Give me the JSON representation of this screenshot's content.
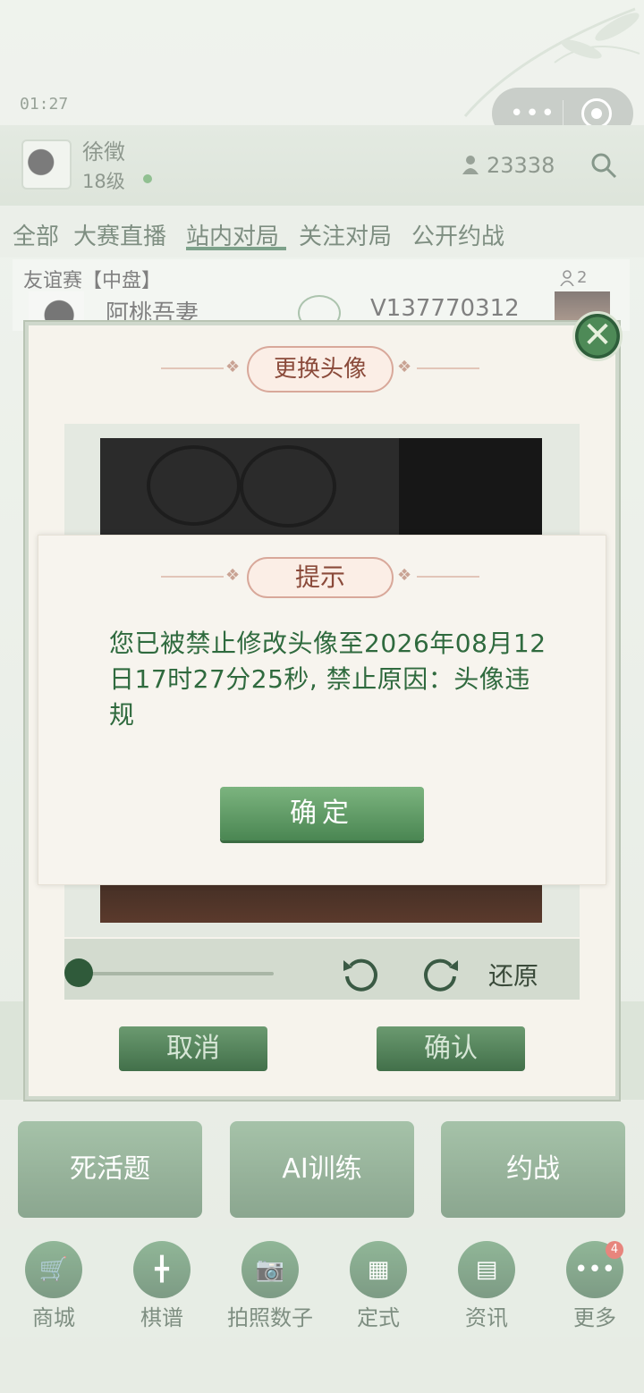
{
  "status_bar": {
    "time": "01:27"
  },
  "capsule": {
    "menu_icon": "ellipsis-icon",
    "target_icon": "target-icon"
  },
  "header": {
    "user_name": "徐徵",
    "user_level": "18级",
    "online_count": "23338"
  },
  "tabs": [
    "全部",
    "大赛直播",
    "站内对局",
    "关注对局",
    "公开约战"
  ],
  "active_tab": "站内对局",
  "match": {
    "title": "友谊赛【中盘】",
    "viewers": "2",
    "player1": "阿桃吾妻",
    "player2": "V137770312"
  },
  "avatar_dialog": {
    "title": "更换头像",
    "restore_label": "还原",
    "cancel_label": "取消",
    "confirm_label": "确认",
    "zoom_level": 0
  },
  "hint_dialog": {
    "title": "提示",
    "message": "您已被禁止修改头像至2026年08月12日17时27分25秒, 禁止原因：头像违规",
    "ok_label": "确定"
  },
  "bottom_buttons": [
    "死活题",
    "AI训练",
    "约战"
  ],
  "nav": [
    {
      "label": "商城",
      "icon": "cart-icon"
    },
    {
      "label": "棋谱",
      "icon": "board-icon"
    },
    {
      "label": "拍照数子",
      "icon": "camera-icon"
    },
    {
      "label": "定式",
      "icon": "pattern-icon"
    },
    {
      "label": "资讯",
      "icon": "news-icon"
    },
    {
      "label": "更多",
      "icon": "more-icon"
    }
  ],
  "more_badge": "4",
  "colors": {
    "primary_green": "#4a8652",
    "title_text": "#8a4a3a",
    "message_text": "#2f6a3e"
  }
}
